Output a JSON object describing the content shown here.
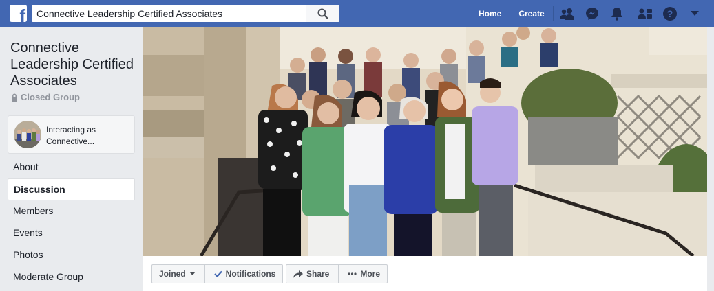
{
  "topbar": {
    "logo": "f",
    "search_value": "Connective Leadership Certified Associates",
    "search_placeholder": "Search",
    "nav_home": "Home",
    "nav_create": "Create",
    "icons": [
      "friends-icon",
      "messenger-icon",
      "notifications-icon",
      "groups-icon",
      "help-icon",
      "dropdown-icon"
    ]
  },
  "group": {
    "title": "Connective Leadership Certified Associates",
    "privacy": "Closed Group",
    "interacting_line1": "Interacting as",
    "interacting_line2": "Connective..."
  },
  "sidebar": {
    "items": [
      {
        "label": "About",
        "active": false
      },
      {
        "label": "Discussion",
        "active": true
      },
      {
        "label": "Members",
        "active": false
      },
      {
        "label": "Events",
        "active": false
      },
      {
        "label": "Photos",
        "active": false
      },
      {
        "label": "Moderate Group",
        "active": false
      }
    ]
  },
  "actions": {
    "joined": "Joined",
    "notifications": "Notifications",
    "share": "Share",
    "more": "More"
  },
  "colors": {
    "brand": "#4267b2",
    "background": "#e9ebee",
    "check": "#4267b2"
  }
}
